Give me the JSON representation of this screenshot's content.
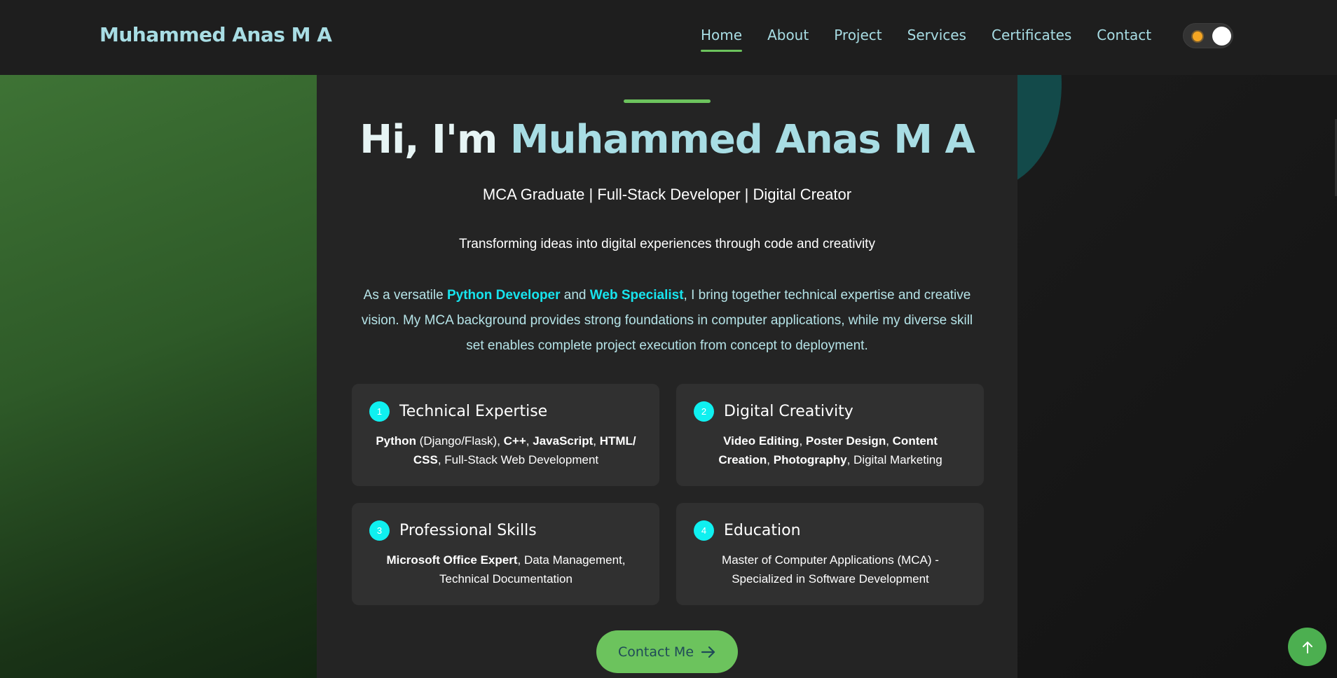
{
  "navbar": {
    "brand": "Muhammed Anas M A",
    "links": [
      {
        "label": "Home",
        "active": true
      },
      {
        "label": "About"
      },
      {
        "label": "Project"
      },
      {
        "label": "Services"
      },
      {
        "label": "Certificates"
      },
      {
        "label": "Contact"
      }
    ],
    "theme_toggle_icon": "sun-icon"
  },
  "hero": {
    "greeting": "Hi, I'm ",
    "name": "Muhammed Anas M A",
    "subtitle": "MCA Graduate | Full-Stack Developer | Digital Creator",
    "tagline": "Transforming ideas into digital experiences through code and creativity",
    "intro": {
      "p1": "As a versatile ",
      "hl1": "Python Developer",
      "p2": " and ",
      "hl2": "Web Specialist",
      "p3": ", I bring together technical expertise and creative vision. My MCA background provides strong foundations in computer applications, while my diverse skill set enables complete project execution from concept to deployment."
    }
  },
  "features": [
    {
      "num": "1",
      "title": "Technical Expertise",
      "desc": [
        {
          "b": "Python"
        },
        {
          "t": " (Django/Flask), "
        },
        {
          "b": "C++"
        },
        {
          "t": ", "
        },
        {
          "b": "JavaScript"
        },
        {
          "t": ", "
        },
        {
          "b": "HTML/ CSS"
        },
        {
          "t": ", Full-Stack Web Development"
        }
      ]
    },
    {
      "num": "2",
      "title": "Digital Creativity",
      "desc": [
        {
          "b": "Video Editing"
        },
        {
          "t": ", "
        },
        {
          "b": "Poster Design"
        },
        {
          "t": ", "
        },
        {
          "b": "Content Creation"
        },
        {
          "t": ", "
        },
        {
          "b": "Photography"
        },
        {
          "t": ", Digital Marketing"
        }
      ]
    },
    {
      "num": "3",
      "title": "Professional Skills",
      "desc": [
        {
          "b": "Microsoft Office Expert"
        },
        {
          "t": ", Data Management, Technical Documentation"
        }
      ]
    },
    {
      "num": "4",
      "title": "Education",
      "desc": [
        {
          "t": "Master of Computer Applications (MCA) - Specialized in Software Development"
        }
      ]
    }
  ],
  "contact_button": {
    "label": "Contact Me",
    "icon": "arrow-right-icon"
  },
  "scroll_top": {
    "icon": "arrow-up-icon"
  },
  "colors": {
    "accent_green": "#6cc35d",
    "accent_cyan": "#17e4ee",
    "brand_teal": "#a8dde4",
    "card_bg": "#242424"
  }
}
